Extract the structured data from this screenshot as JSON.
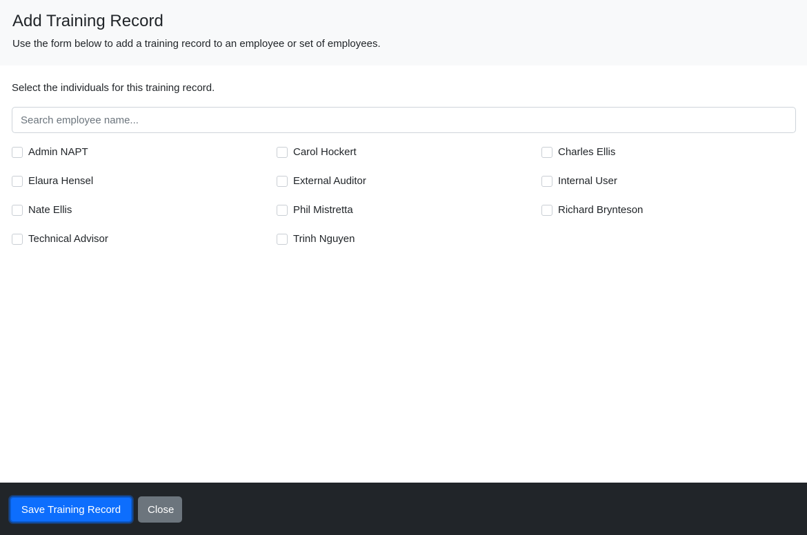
{
  "header": {
    "title": "Add Training Record",
    "subtitle": "Use the form below to add a training record to an employee or set of employees."
  },
  "form": {
    "instructions": "Select the individuals for this training record.",
    "search": {
      "placeholder": "Search employee name...",
      "value": ""
    },
    "employees": [
      {
        "name": "Admin NAPT",
        "checked": false
      },
      {
        "name": "Carol Hockert",
        "checked": false
      },
      {
        "name": "Charles Ellis",
        "checked": false
      },
      {
        "name": "Elaura Hensel",
        "checked": false
      },
      {
        "name": "External Auditor",
        "checked": false
      },
      {
        "name": "Internal User",
        "checked": false
      },
      {
        "name": "Nate Ellis",
        "checked": false
      },
      {
        "name": "Phil Mistretta",
        "checked": false
      },
      {
        "name": "Richard Brynteson",
        "checked": false
      },
      {
        "name": "Technical Advisor",
        "checked": false
      },
      {
        "name": "Trinh Nguyen",
        "checked": false
      }
    ]
  },
  "footer": {
    "save_label": "Save Training Record",
    "close_label": "Close"
  },
  "colors": {
    "primary": "#0d6efd",
    "secondary": "#6c757d",
    "footer_bg": "#212529",
    "header_bg": "#f8f9fa"
  }
}
